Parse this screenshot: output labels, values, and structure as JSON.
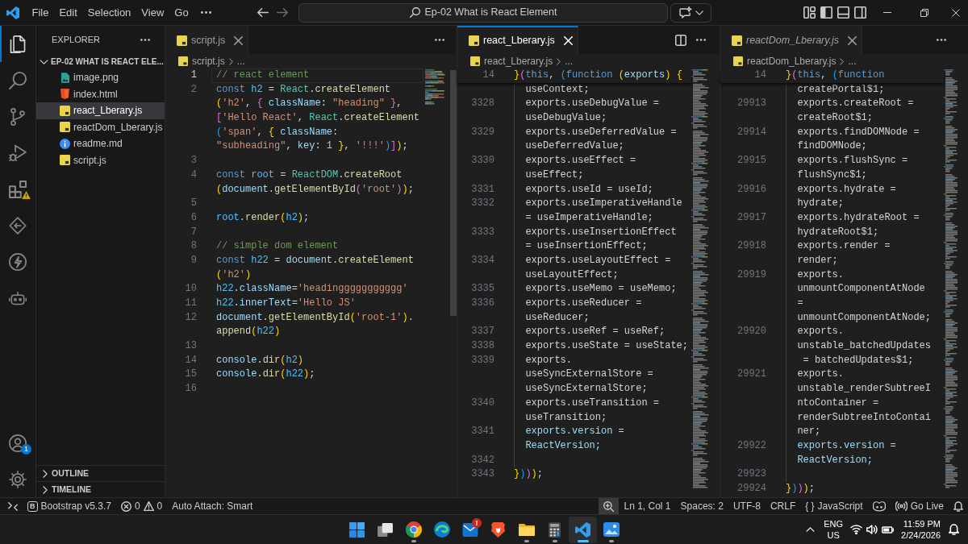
{
  "title_bar": {
    "menu": [
      "File",
      "Edit",
      "Selection",
      "View",
      "Go"
    ],
    "command_center": "Ep-02 What is React Element"
  },
  "activity_bar": {
    "items": [
      {
        "kind": "explorer",
        "selected": true,
        "warning": false
      },
      {
        "kind": "search",
        "selected": false,
        "warning": false
      },
      {
        "kind": "source_control",
        "selected": false,
        "warning": false
      },
      {
        "kind": "run_debug",
        "selected": false,
        "warning": false
      },
      {
        "kind": "extensions",
        "selected": false,
        "warning": true
      },
      {
        "kind": "diamond",
        "selected": false,
        "warning": false
      },
      {
        "kind": "bolt",
        "selected": false,
        "warning": false
      },
      {
        "kind": "robot",
        "selected": false,
        "warning": false
      }
    ],
    "bottom": [
      {
        "kind": "accounts",
        "badge": "1"
      },
      {
        "kind": "settings"
      }
    ]
  },
  "sidebar": {
    "title": "EXPLORER",
    "folder": {
      "name": "EP-02 WHAT IS REACT ELE...",
      "expanded": true
    },
    "files": [
      {
        "label": "image.png",
        "kind": "image",
        "selected": false
      },
      {
        "label": "index.html",
        "kind": "html",
        "selected": false
      },
      {
        "label": "react_Lberary.js",
        "kind": "js",
        "selected": true
      },
      {
        "label": "reactDom_Lberary.js",
        "kind": "js",
        "selected": false
      },
      {
        "label": "readme.md",
        "kind": "readme",
        "selected": false
      },
      {
        "label": "script.js",
        "kind": "js",
        "selected": false
      }
    ],
    "sections": [
      {
        "title": "OUTLINE",
        "expanded": false
      },
      {
        "title": "TIMELINE",
        "expanded": false
      }
    ]
  },
  "editor_groups": [
    {
      "focused": false,
      "tab": {
        "label": "script.js",
        "preview": false
      },
      "breadcrumb": [
        "script.js",
        "..."
      ],
      "lines": [
        {
          "number": "1",
          "current": true,
          "rows": [
            {
              "tokens": [
                {
                  "kind": "comment",
                  "text": "// react element"
                }
              ]
            }
          ]
        },
        {
          "number": "2",
          "current": false,
          "rows": [
            {
              "tokens": [
                {
                  "kind": "keyword",
                  "text": "const "
                },
                {
                  "kind": "constant",
                  "text": "h2"
                },
                {
                  "kind": "plain",
                  "text": " = "
                },
                {
                  "kind": "class",
                  "text": "React"
                },
                {
                  "kind": "plain",
                  "text": "."
                },
                {
                  "kind": "function",
                  "text": "createElement"
                }
              ]
            },
            {
              "tokens": [
                {
                  "kind": "bracket1",
                  "text": "("
                },
                {
                  "kind": "string",
                  "text": "'h2'"
                },
                {
                  "kind": "plain",
                  "text": ", "
                },
                {
                  "kind": "bracket2",
                  "text": "{ "
                },
                {
                  "kind": "property",
                  "text": "className"
                },
                {
                  "kind": "plain",
                  "text": ": "
                },
                {
                  "kind": "string",
                  "text": "\"heading\""
                },
                {
                  "kind": "bracket2",
                  "text": " }"
                },
                {
                  "kind": "plain",
                  "text": ","
                }
              ]
            },
            {
              "tokens": [
                {
                  "kind": "bracket2",
                  "text": "["
                },
                {
                  "kind": "string",
                  "text": "'Hello React'"
                },
                {
                  "kind": "plain",
                  "text": ", "
                },
                {
                  "kind": "class",
                  "text": "React"
                },
                {
                  "kind": "plain",
                  "text": "."
                },
                {
                  "kind": "function",
                  "text": "createElement"
                }
              ]
            },
            {
              "tokens": [
                {
                  "kind": "bracket3",
                  "text": "("
                },
                {
                  "kind": "string",
                  "text": "'span'"
                },
                {
                  "kind": "plain",
                  "text": ", "
                },
                {
                  "kind": "bracket1",
                  "text": "{ "
                },
                {
                  "kind": "property",
                  "text": "className"
                },
                {
                  "kind": "plain",
                  "text": ":"
                }
              ]
            },
            {
              "tokens": [
                {
                  "kind": "string",
                  "text": "\"subheading\""
                },
                {
                  "kind": "plain",
                  "text": ", "
                },
                {
                  "kind": "property",
                  "text": "key"
                },
                {
                  "kind": "plain",
                  "text": ": "
                },
                {
                  "kind": "number",
                  "text": "1"
                },
                {
                  "kind": "bracket1",
                  "text": " }"
                },
                {
                  "kind": "plain",
                  "text": ", "
                },
                {
                  "kind": "string",
                  "text": "'!!!'"
                },
                {
                  "kind": "bracket3",
                  "text": ")"
                },
                {
                  "kind": "bracket2",
                  "text": "]"
                },
                {
                  "kind": "bracket1",
                  "text": ")"
                },
                {
                  "kind": "plain",
                  "text": ";"
                }
              ]
            }
          ]
        },
        {
          "number": "3",
          "current": false
        },
        {
          "number": "4",
          "current": false,
          "rows": [
            {
              "tokens": [
                {
                  "kind": "keyword",
                  "text": "const "
                },
                {
                  "kind": "constant",
                  "text": "root"
                },
                {
                  "kind": "plain",
                  "text": " = "
                },
                {
                  "kind": "class",
                  "text": "ReactDOM"
                },
                {
                  "kind": "plain",
                  "text": "."
                },
                {
                  "kind": "function",
                  "text": "createRoot"
                }
              ]
            },
            {
              "tokens": [
                {
                  "kind": "bracket1",
                  "text": "("
                },
                {
                  "kind": "variable",
                  "text": "document"
                },
                {
                  "kind": "plain",
                  "text": "."
                },
                {
                  "kind": "function",
                  "text": "getElementById"
                },
                {
                  "kind": "bracket2",
                  "text": "("
                },
                {
                  "kind": "string",
                  "text": "'root'"
                },
                {
                  "kind": "bracket2",
                  "text": ")"
                },
                {
                  "kind": "bracket1",
                  "text": ")"
                },
                {
                  "kind": "plain",
                  "text": ";"
                }
              ]
            }
          ]
        },
        {
          "number": "5",
          "current": false
        },
        {
          "number": "6",
          "current": false,
          "rows": [
            {
              "tokens": [
                {
                  "kind": "constant",
                  "text": "root"
                },
                {
                  "kind": "plain",
                  "text": "."
                },
                {
                  "kind": "function",
                  "text": "render"
                },
                {
                  "kind": "bracket1",
                  "text": "("
                },
                {
                  "kind": "constant",
                  "text": "h2"
                },
                {
                  "kind": "bracket1",
                  "text": ")"
                },
                {
                  "kind": "plain",
                  "text": ";"
                }
              ]
            }
          ]
        },
        {
          "number": "7",
          "current": false
        },
        {
          "number": "8",
          "current": false,
          "rows": [
            {
              "tokens": [
                {
                  "kind": "comment",
                  "text": "// simple dom element"
                }
              ]
            }
          ]
        },
        {
          "number": "9",
          "current": false,
          "rows": [
            {
              "tokens": [
                {
                  "kind": "keyword",
                  "text": "const "
                },
                {
                  "kind": "constant",
                  "text": "h22"
                },
                {
                  "kind": "plain",
                  "text": " = "
                },
                {
                  "kind": "variable",
                  "text": "document"
                },
                {
                  "kind": "plain",
                  "text": "."
                },
                {
                  "kind": "function",
                  "text": "createElement"
                }
              ]
            },
            {
              "tokens": [
                {
                  "kind": "bracket1",
                  "text": "("
                },
                {
                  "kind": "string",
                  "text": "'h2'"
                },
                {
                  "kind": "bracket1",
                  "text": ")"
                }
              ]
            }
          ]
        },
        {
          "number": "10",
          "current": false,
          "rows": [
            {
              "tokens": [
                {
                  "kind": "constant",
                  "text": "h22"
                },
                {
                  "kind": "plain",
                  "text": "."
                },
                {
                  "kind": "property",
                  "text": "className"
                },
                {
                  "kind": "plain",
                  "text": "="
                },
                {
                  "kind": "string",
                  "text": "'headinggggggggggg'"
                }
              ]
            }
          ]
        },
        {
          "number": "11",
          "current": false,
          "rows": [
            {
              "tokens": [
                {
                  "kind": "constant",
                  "text": "h22"
                },
                {
                  "kind": "plain",
                  "text": "."
                },
                {
                  "kind": "property",
                  "text": "innerText"
                },
                {
                  "kind": "plain",
                  "text": "="
                },
                {
                  "kind": "string",
                  "text": "'Hello JS'"
                }
              ]
            }
          ]
        },
        {
          "number": "12",
          "current": false,
          "rows": [
            {
              "tokens": [
                {
                  "kind": "variable",
                  "text": "document"
                },
                {
                  "kind": "plain",
                  "text": "."
                },
                {
                  "kind": "function",
                  "text": "getElementById"
                },
                {
                  "kind": "bracket1",
                  "text": "("
                },
                {
                  "kind": "string",
                  "text": "'root-1'"
                },
                {
                  "kind": "bracket1",
                  "text": ")"
                },
                {
                  "kind": "plain",
                  "text": "."
                }
              ]
            },
            {
              "tokens": [
                {
                  "kind": "function",
                  "text": "append"
                },
                {
                  "kind": "bracket1",
                  "text": "("
                },
                {
                  "kind": "constant",
                  "text": "h22"
                },
                {
                  "kind": "bracket1",
                  "text": ")"
                }
              ]
            }
          ]
        },
        {
          "number": "13",
          "current": false
        },
        {
          "number": "14",
          "current": false,
          "rows": [
            {
              "tokens": [
                {
                  "kind": "variable",
                  "text": "console"
                },
                {
                  "kind": "plain",
                  "text": "."
                },
                {
                  "kind": "function",
                  "text": "dir"
                },
                {
                  "kind": "bracket1",
                  "text": "("
                },
                {
                  "kind": "constant",
                  "text": "h2"
                },
                {
                  "kind": "bracket1",
                  "text": ")"
                }
              ]
            }
          ]
        },
        {
          "number": "15",
          "current": false,
          "rows": [
            {
              "tokens": [
                {
                  "kind": "variable",
                  "text": "console"
                },
                {
                  "kind": "plain",
                  "text": "."
                },
                {
                  "kind": "function",
                  "text": "dir"
                },
                {
                  "kind": "bracket1",
                  "text": "("
                },
                {
                  "kind": "constant",
                  "text": "h22"
                },
                {
                  "kind": "bracket1",
                  "text": ")"
                },
                {
                  "kind": "plain",
                  "text": ";"
                }
              ]
            }
          ]
        },
        {
          "number": "16",
          "current": false
        }
      ]
    },
    {
      "focused": true,
      "tab": {
        "label": "react_Lberary.js",
        "preview": false
      },
      "breadcrumb": [
        "react_Lberary.js",
        "..."
      ],
      "sticky_line": {
        "number": "14",
        "rows": [
          {
            "tokens": [
              {
                "kind": "bracket1",
                "text": "}"
              },
              {
                "kind": "bracket2",
                "text": "("
              },
              {
                "kind": "keyword",
                "text": "this"
              },
              {
                "kind": "plain",
                "text": ", "
              },
              {
                "kind": "bracket3",
                "text": "("
              },
              {
                "kind": "keyword",
                "text": "function "
              },
              {
                "kind": "bracket1",
                "text": "("
              },
              {
                "kind": "variable",
                "text": "exports"
              },
              {
                "kind": "bracket1",
                "text": ") {"
              }
            ]
          }
        ]
      },
      "lines": [
        {
          "indented": true,
          "rows": [
            {
              "tokens": [
                {
                  "kind": "plain",
                  "text": "useContext;"
                }
              ]
            }
          ]
        },
        {
          "number": "3328",
          "indented": true,
          "rows": [
            {
              "tokens": [
                {
                  "kind": "plain",
                  "text": "exports.useDebugValue ="
                }
              ]
            },
            {
              "tokens": [
                {
                  "kind": "plain",
                  "text": "useDebugValue;"
                }
              ]
            }
          ]
        },
        {
          "number": "3329",
          "indented": true,
          "rows": [
            {
              "tokens": [
                {
                  "kind": "plain",
                  "text": "exports.useDeferredValue ="
                }
              ]
            },
            {
              "tokens": [
                {
                  "kind": "plain",
                  "text": "useDeferredValue;"
                }
              ]
            }
          ]
        },
        {
          "number": "3330",
          "indented": true,
          "rows": [
            {
              "tokens": [
                {
                  "kind": "plain",
                  "text": "exports.useEffect ="
                }
              ]
            },
            {
              "tokens": [
                {
                  "kind": "plain",
                  "text": "useEffect;"
                }
              ]
            }
          ]
        },
        {
          "number": "3331",
          "indented": true,
          "rows": [
            {
              "tokens": [
                {
                  "kind": "plain",
                  "text": "exports.useId = useId;"
                }
              ]
            }
          ]
        },
        {
          "number": "3332",
          "indented": true,
          "rows": [
            {
              "tokens": [
                {
                  "kind": "plain",
                  "text": "exports.useImperativeHandle"
                }
              ]
            },
            {
              "tokens": [
                {
                  "kind": "plain",
                  "text": "= useImperativeHandle;"
                }
              ]
            }
          ]
        },
        {
          "number": "3333",
          "indented": true,
          "rows": [
            {
              "tokens": [
                {
                  "kind": "plain",
                  "text": "exports.useInsertionEffect"
                }
              ]
            },
            {
              "tokens": [
                {
                  "kind": "plain",
                  "text": "= useInsertionEffect;"
                }
              ]
            }
          ]
        },
        {
          "number": "3334",
          "indented": true,
          "rows": [
            {
              "tokens": [
                {
                  "kind": "plain",
                  "text": "exports.useLayoutEffect ="
                }
              ]
            },
            {
              "tokens": [
                {
                  "kind": "plain",
                  "text": "useLayoutEffect;"
                }
              ]
            }
          ]
        },
        {
          "number": "3335",
          "indented": true,
          "rows": [
            {
              "tokens": [
                {
                  "kind": "plain",
                  "text": "exports.useMemo = useMemo;"
                }
              ]
            }
          ]
        },
        {
          "number": "3336",
          "indented": true,
          "rows": [
            {
              "tokens": [
                {
                  "kind": "plain",
                  "text": "exports.useReducer ="
                }
              ]
            },
            {
              "tokens": [
                {
                  "kind": "plain",
                  "text": "useReducer;"
                }
              ]
            }
          ]
        },
        {
          "number": "3337",
          "indented": true,
          "rows": [
            {
              "tokens": [
                {
                  "kind": "plain",
                  "text": "exports.useRef = useRef;"
                }
              ]
            }
          ]
        },
        {
          "number": "3338",
          "indented": true,
          "rows": [
            {
              "tokens": [
                {
                  "kind": "plain",
                  "text": "exports.useState = useState;"
                }
              ]
            }
          ]
        },
        {
          "number": "3339",
          "indented": true,
          "rows": [
            {
              "tokens": [
                {
                  "kind": "plain",
                  "text": "exports."
                }
              ]
            },
            {
              "tokens": [
                {
                  "kind": "plain",
                  "text": "useSyncExternalStore ="
                }
              ]
            },
            {
              "tokens": [
                {
                  "kind": "plain",
                  "text": "useSyncExternalStore;"
                }
              ]
            }
          ]
        },
        {
          "number": "3340",
          "indented": true,
          "rows": [
            {
              "tokens": [
                {
                  "kind": "plain",
                  "text": "exports.useTransition ="
                }
              ]
            },
            {
              "tokens": [
                {
                  "kind": "plain",
                  "text": "useTransition;"
                }
              ]
            }
          ]
        },
        {
          "number": "3341",
          "indented": true,
          "rows": [
            {
              "tokens": [
                {
                  "kind": "variable",
                  "text": "exports.version"
                },
                {
                  "kind": "plain",
                  "text": " ="
                }
              ]
            },
            {
              "tokens": [
                {
                  "kind": "variable",
                  "text": "ReactVersion;"
                }
              ]
            }
          ]
        },
        {
          "number": "3342",
          "indented": true
        },
        {
          "number": "3343",
          "indented": false,
          "rows": [
            {
              "tokens": [
                {
                  "kind": "bracket1",
                  "text": "}"
                },
                {
                  "kind": "bracket3",
                  "text": ")"
                },
                {
                  "kind": "bracket2",
                  "text": ")"
                },
                {
                  "kind": "bracket1",
                  "text": ")"
                },
                {
                  "kind": "plain",
                  "text": ";"
                }
              ]
            }
          ]
        }
      ]
    },
    {
      "focused": false,
      "tab": {
        "label": "reactDom_Lberary.js",
        "preview": true
      },
      "breadcrumb": [
        "reactDom_Lberary.js",
        "..."
      ],
      "sticky_line": {
        "number": "14",
        "rows": [
          {
            "tokens": [
              {
                "kind": "bracket1",
                "text": "}"
              },
              {
                "kind": "bracket2",
                "text": "("
              },
              {
                "kind": "keyword",
                "text": "this"
              },
              {
                "kind": "plain",
                "text": ", "
              },
              {
                "kind": "bracket3",
                "text": "("
              },
              {
                "kind": "keyword",
                "text": "function"
              }
            ]
          }
        ]
      },
      "lines": [
        {
          "indented": true,
          "rows": [
            {
              "tokens": [
                {
                  "kind": "plain",
                  "text": "createPortal$1;"
                }
              ]
            }
          ]
        },
        {
          "number": "29913",
          "indented": true,
          "rows": [
            {
              "tokens": [
                {
                  "kind": "plain",
                  "text": "exports.createRoot ="
                }
              ]
            },
            {
              "tokens": [
                {
                  "kind": "plain",
                  "text": "createRoot$1;"
                }
              ]
            }
          ]
        },
        {
          "number": "29914",
          "indented": true,
          "rows": [
            {
              "tokens": [
                {
                  "kind": "plain",
                  "text": "exports.findDOMNode ="
                }
              ]
            },
            {
              "tokens": [
                {
                  "kind": "plain",
                  "text": "findDOMNode;"
                }
              ]
            }
          ]
        },
        {
          "number": "29915",
          "indented": true,
          "rows": [
            {
              "tokens": [
                {
                  "kind": "plain",
                  "text": "exports.flushSync ="
                }
              ]
            },
            {
              "tokens": [
                {
                  "kind": "plain",
                  "text": "flushSync$1;"
                }
              ]
            }
          ]
        },
        {
          "number": "29916",
          "indented": true,
          "rows": [
            {
              "tokens": [
                {
                  "kind": "plain",
                  "text": "exports.hydrate ="
                }
              ]
            },
            {
              "tokens": [
                {
                  "kind": "plain",
                  "text": "hydrate;"
                }
              ]
            }
          ]
        },
        {
          "number": "29917",
          "indented": true,
          "rows": [
            {
              "tokens": [
                {
                  "kind": "plain",
                  "text": "exports.hydrateRoot ="
                }
              ]
            },
            {
              "tokens": [
                {
                  "kind": "plain",
                  "text": "hydrateRoot$1;"
                }
              ]
            }
          ]
        },
        {
          "number": "29918",
          "indented": true,
          "rows": [
            {
              "tokens": [
                {
                  "kind": "plain",
                  "text": "exports.render ="
                }
              ]
            },
            {
              "tokens": [
                {
                  "kind": "plain",
                  "text": "render;"
                }
              ]
            }
          ]
        },
        {
          "number": "29919",
          "indented": true,
          "rows": [
            {
              "tokens": [
                {
                  "kind": "plain",
                  "text": "exports."
                }
              ]
            },
            {
              "tokens": [
                {
                  "kind": "plain",
                  "text": "unmountComponentAtNode"
                }
              ]
            },
            {
              "tokens": [
                {
                  "kind": "plain",
                  "text": "="
                }
              ]
            },
            {
              "tokens": [
                {
                  "kind": "plain",
                  "text": "unmountComponentAtNode;"
                }
              ]
            }
          ]
        },
        {
          "number": "29920",
          "indented": true,
          "rows": [
            {
              "tokens": [
                {
                  "kind": "plain",
                  "text": "exports."
                }
              ]
            },
            {
              "tokens": [
                {
                  "kind": "plain",
                  "text": "unstable_batchedUpdates"
                }
              ]
            },
            {
              "tokens": [
                {
                  "kind": "plain",
                  "text": " = batchedUpdates$1;"
                }
              ]
            }
          ]
        },
        {
          "number": "29921",
          "indented": true,
          "rows": [
            {
              "tokens": [
                {
                  "kind": "plain",
                  "text": "exports."
                }
              ]
            },
            {
              "tokens": [
                {
                  "kind": "plain",
                  "text": "unstable_renderSubtreeI"
                }
              ]
            },
            {
              "tokens": [
                {
                  "kind": "plain",
                  "text": "ntoContainer ="
                }
              ]
            },
            {
              "tokens": [
                {
                  "kind": "plain",
                  "text": "renderSubtreeIntoContai"
                }
              ]
            },
            {
              "tokens": [
                {
                  "kind": "plain",
                  "text": "ner;"
                }
              ]
            }
          ]
        },
        {
          "number": "29922",
          "indented": true,
          "rows": [
            {
              "tokens": [
                {
                  "kind": "variable",
                  "text": "exports.version"
                },
                {
                  "kind": "plain",
                  "text": " ="
                }
              ]
            },
            {
              "tokens": [
                {
                  "kind": "variable",
                  "text": "ReactVersion;"
                }
              ]
            }
          ]
        },
        {
          "number": "29923",
          "indented": true
        },
        {
          "number": "29924",
          "indented": false,
          "rows": [
            {
              "tokens": [
                {
                  "kind": "bracket1",
                  "text": "}"
                },
                {
                  "kind": "bracket3",
                  "text": ")"
                },
                {
                  "kind": "bracket2",
                  "text": ")"
                },
                {
                  "kind": "bracket1",
                  "text": ")"
                },
                {
                  "kind": "plain",
                  "text": ";"
                }
              ]
            }
          ]
        }
      ]
    }
  ],
  "status_bar": {
    "left": [
      {
        "kind": "remote",
        "highlighted": false
      },
      {
        "kind": "extension",
        "symbol": "B",
        "label": "Bootstrap v5.3.7",
        "highlighted": false
      },
      {
        "kind": "problems",
        "errors": "0",
        "warnings": "0",
        "highlighted": false
      },
      {
        "kind": "text",
        "label": "Auto Attach: Smart",
        "highlighted": false
      }
    ],
    "right": [
      {
        "kind": "zoom",
        "highlighted": true
      },
      {
        "kind": "text",
        "label": "Ln 1, Col 1",
        "highlighted": false
      },
      {
        "kind": "text",
        "label": "Spaces: 2",
        "highlighted": false
      },
      {
        "kind": "text",
        "label": "UTF-8",
        "highlighted": false
      },
      {
        "kind": "text",
        "label": "CRLF",
        "highlighted": false
      },
      {
        "kind": "language",
        "symbol": "{ }",
        "label": "JavaScript",
        "highlighted": false
      },
      {
        "kind": "copilot",
        "highlighted": false
      },
      {
        "kind": "live",
        "label": "Go Live",
        "highlighted": false
      },
      {
        "kind": "bell",
        "highlighted": false
      }
    ]
  },
  "taskbar": {
    "apps": [
      {
        "kind": "start",
        "running": false,
        "selected": false
      },
      {
        "kind": "task_view",
        "running": false,
        "selected": false
      },
      {
        "kind": "chrome",
        "running": true,
        "selected": false
      },
      {
        "kind": "edge",
        "running": false,
        "selected": false
      },
      {
        "kind": "mail",
        "running": false,
        "selected": false,
        "badge": "!"
      },
      {
        "kind": "brave",
        "running": false,
        "selected": false
      },
      {
        "kind": "files",
        "running": true,
        "selected": false
      },
      {
        "kind": "calculator",
        "running": true,
        "selected": false
      },
      {
        "kind": "vscode",
        "running": true,
        "selected": true
      },
      {
        "kind": "photos",
        "running": true,
        "selected": false
      }
    ],
    "tray": {
      "language": "ENG",
      "region": "US",
      "time": "11:59 PM",
      "date": "2/24/2026"
    }
  }
}
